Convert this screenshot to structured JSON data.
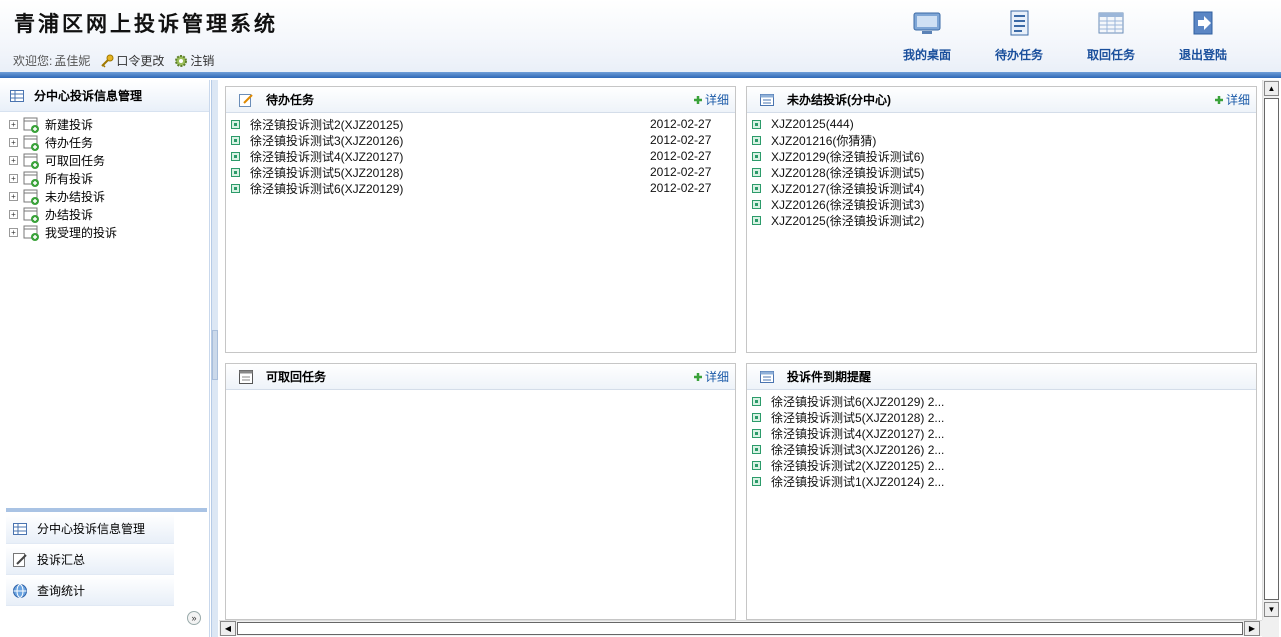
{
  "header": {
    "title": "青浦区网上投诉管理系统",
    "welcome_label": "欢迎您:",
    "user_name": "孟佳妮",
    "change_password": "口令更改",
    "logout": "注销",
    "nav": [
      {
        "label": "我的桌面",
        "icon": "monitor-icon"
      },
      {
        "label": "待办任务",
        "icon": "document-list-icon"
      },
      {
        "label": "取回任务",
        "icon": "table-icon"
      },
      {
        "label": "退出登陆",
        "icon": "exit-arrow-icon"
      }
    ]
  },
  "sidebar": {
    "heading": "分中心投诉信息管理",
    "tree": [
      {
        "label": "新建投诉"
      },
      {
        "label": "待办任务"
      },
      {
        "label": "可取回任务"
      },
      {
        "label": "所有投诉"
      },
      {
        "label": "未办结投诉"
      },
      {
        "label": "办结投诉"
      },
      {
        "label": "我受理的投诉"
      }
    ],
    "sections": [
      {
        "label": "分中心投诉信息管理",
        "icon": "grid-icon"
      },
      {
        "label": "投诉汇总",
        "icon": "pencil-icon"
      },
      {
        "label": "查询统计",
        "icon": "globe-icon"
      }
    ],
    "collapse_glyph": "»"
  },
  "panels": {
    "todo": {
      "title": "待办任务",
      "more": "详细",
      "items": [
        {
          "text": "徐泾镇投诉测试2(XJZ20125)",
          "date": "2012-02-27"
        },
        {
          "text": "徐泾镇投诉测试3(XJZ20126)",
          "date": "2012-02-27"
        },
        {
          "text": "徐泾镇投诉测试4(XJZ20127)",
          "date": "2012-02-27"
        },
        {
          "text": "徐泾镇投诉测试5(XJZ20128)",
          "date": "2012-02-27"
        },
        {
          "text": "徐泾镇投诉测试6(XJZ20129)",
          "date": "2012-02-27"
        }
      ]
    },
    "unfinished": {
      "title": "未办结投诉(分中心)",
      "more": "详细",
      "items": [
        {
          "text": "XJZ20125(444)"
        },
        {
          "text": "XJZ201216(你猜猜)"
        },
        {
          "text": "XJZ20129(徐泾镇投诉测试6)"
        },
        {
          "text": "XJZ20128(徐泾镇投诉测试5)"
        },
        {
          "text": "XJZ20127(徐泾镇投诉测试4)"
        },
        {
          "text": "XJZ20126(徐泾镇投诉测试3)"
        },
        {
          "text": "XJZ20125(徐泾镇投诉测试2)"
        }
      ]
    },
    "retrievable": {
      "title": "可取回任务",
      "more": "详细",
      "items": []
    },
    "due": {
      "title": "投诉件到期提醒",
      "items": [
        {
          "text": "徐泾镇投诉测试6(XJZ20129) 2..."
        },
        {
          "text": "徐泾镇投诉测试5(XJZ20128) 2..."
        },
        {
          "text": "徐泾镇投诉测试4(XJZ20127) 2..."
        },
        {
          "text": "徐泾镇投诉测试3(XJZ20126) 2..."
        },
        {
          "text": "徐泾镇投诉测试2(XJZ20125) 2..."
        },
        {
          "text": "徐泾镇投诉测试1(XJZ20124) 2..."
        }
      ]
    }
  },
  "colors": {
    "accent": "#1b5aa8",
    "header_stripe": "#2f69b7",
    "bullet": "#2c9b6a"
  }
}
